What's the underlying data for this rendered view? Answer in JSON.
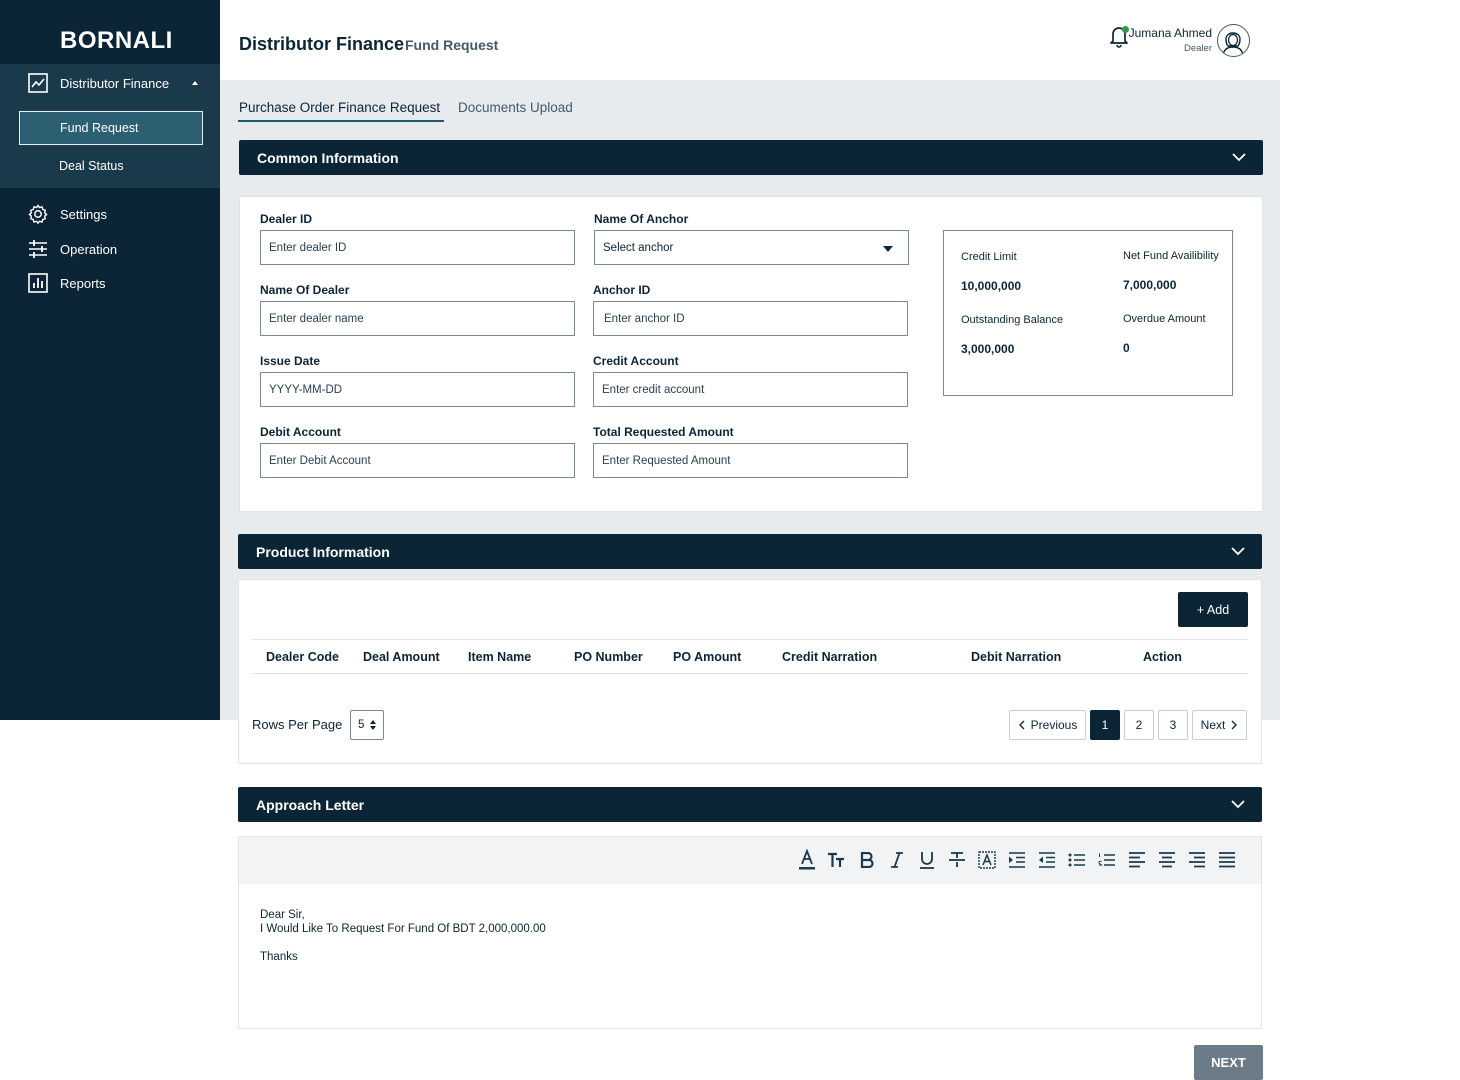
{
  "brand": "BORNALI",
  "sidebar": {
    "group_label": "Distributor Finance",
    "sub_items": [
      {
        "label": "Fund Request"
      },
      {
        "label": "Deal Status"
      }
    ],
    "items": [
      {
        "label": "Settings"
      },
      {
        "label": "Operation"
      },
      {
        "label": "Reports"
      }
    ]
  },
  "header": {
    "title": "Distributor Finance",
    "subtitle": "Fund Request",
    "user_name": "Jumana Ahmed",
    "user_role": "Dealer"
  },
  "tabs": [
    {
      "label": "Purchase Order Finance Request",
      "active": true
    },
    {
      "label": "Documents Upload",
      "active": false
    }
  ],
  "common": {
    "title": "Common Information",
    "dealer_id": {
      "label": "Dealer ID",
      "placeholder": "Enter dealer ID"
    },
    "anchor_name": {
      "label": "Name Of Anchor",
      "value": "Select anchor"
    },
    "dealer_name": {
      "label": "Name Of Dealer",
      "placeholder": "Enter dealer name"
    },
    "anchor_id": {
      "label": "Anchor ID",
      "placeholder": "Enter anchor ID"
    },
    "issue_date": {
      "label": "Issue Date",
      "placeholder": "YYYY-MM-DD"
    },
    "credit_account": {
      "label": "Credit Account",
      "placeholder": "Enter credit account"
    },
    "debit_account": {
      "label": "Debit Account",
      "placeholder": "Enter Debit Account"
    },
    "total_requested": {
      "label": "Total Requested Amount",
      "placeholder": "Enter Requested Amount"
    },
    "summary": {
      "credit_limit_label": "Credit Limit",
      "credit_limit": "10,000,000",
      "net_fund_label": "Net Fund Availibility",
      "net_fund": "7,000,000",
      "outstanding_label": "Outstanding Balance",
      "outstanding": "3,000,000",
      "overdue_label": "Overdue Amount",
      "overdue": "0"
    }
  },
  "product": {
    "title": "Product Information",
    "add_label": "+ Add",
    "columns": [
      "Dealer Code",
      "Deal Amount",
      "Item Name",
      "PO Number",
      "PO Amount",
      "Credit Narration",
      "Debit Narration",
      "Action"
    ],
    "rows_per_page_label": "Rows Per Page",
    "rows_per_page": "5",
    "pagination": {
      "previous": "Previous",
      "pages": [
        "1",
        "2",
        "3"
      ],
      "current": "1",
      "next": "Next"
    }
  },
  "approach": {
    "title": "Approach Letter",
    "toolbar_icons": [
      "font-color-icon",
      "text-size-icon",
      "bold-icon",
      "italic-icon",
      "underline-icon",
      "strikethrough-icon",
      "text-box-icon",
      "indent-icon",
      "outdent-icon",
      "bullet-list-icon",
      "numbered-list-icon",
      "align-left-icon",
      "align-center-icon",
      "align-right-icon",
      "justify-icon"
    ],
    "lines": [
      "Dear Sir,",
      "I Would Like To Request For Fund Of BDT 2,000,000.00",
      "",
      "Thanks"
    ]
  },
  "next_label": "NEXT",
  "colors": {
    "primary": "#0b2537",
    "sidebar_sub": "#1a3a4c",
    "active_item": "#2d5f73",
    "main_bg": "#e8ebee",
    "next_btn": "#6b7c88",
    "notification_dot": "#2b9c46"
  }
}
